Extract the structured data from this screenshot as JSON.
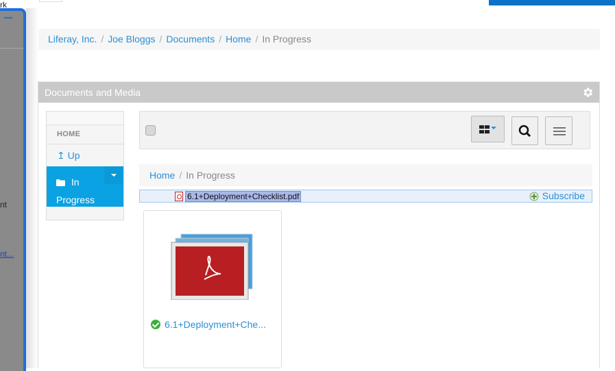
{
  "breadcrumb": {
    "items": [
      "Liferay, Inc.",
      "Joe Bloggs",
      "Documents",
      "Home"
    ],
    "current": "In Progress",
    "separator": "/"
  },
  "side_fragments": [
    "rk",
    "nt",
    "nt..."
  ],
  "portlet": {
    "title": "Documents and Media",
    "icon": "gear-icon"
  },
  "nav": {
    "header": "HOME",
    "up_icon": "↥",
    "up_label": "Up",
    "active_label_line1": "In",
    "active_label_line2": "Progress"
  },
  "toolbar": {
    "view_icon": "grid-view-icon",
    "search_icon": "search-icon",
    "menu_icon": "menu-icon"
  },
  "folder_breadcrumb": {
    "home": "Home",
    "current": "In Progress"
  },
  "drag": {
    "file_name": "6.1+Deployment+Checklist.pdf",
    "subscribe_label": "Subscribe"
  },
  "card": {
    "title": "6.1+Deployment+Che...",
    "status": "approved"
  },
  "colors": {
    "accent": "#0aa2e3",
    "link": "#2a8fd6",
    "portlet_title_bg": "#c9c9c9",
    "top_bar": "#0b72c7"
  }
}
